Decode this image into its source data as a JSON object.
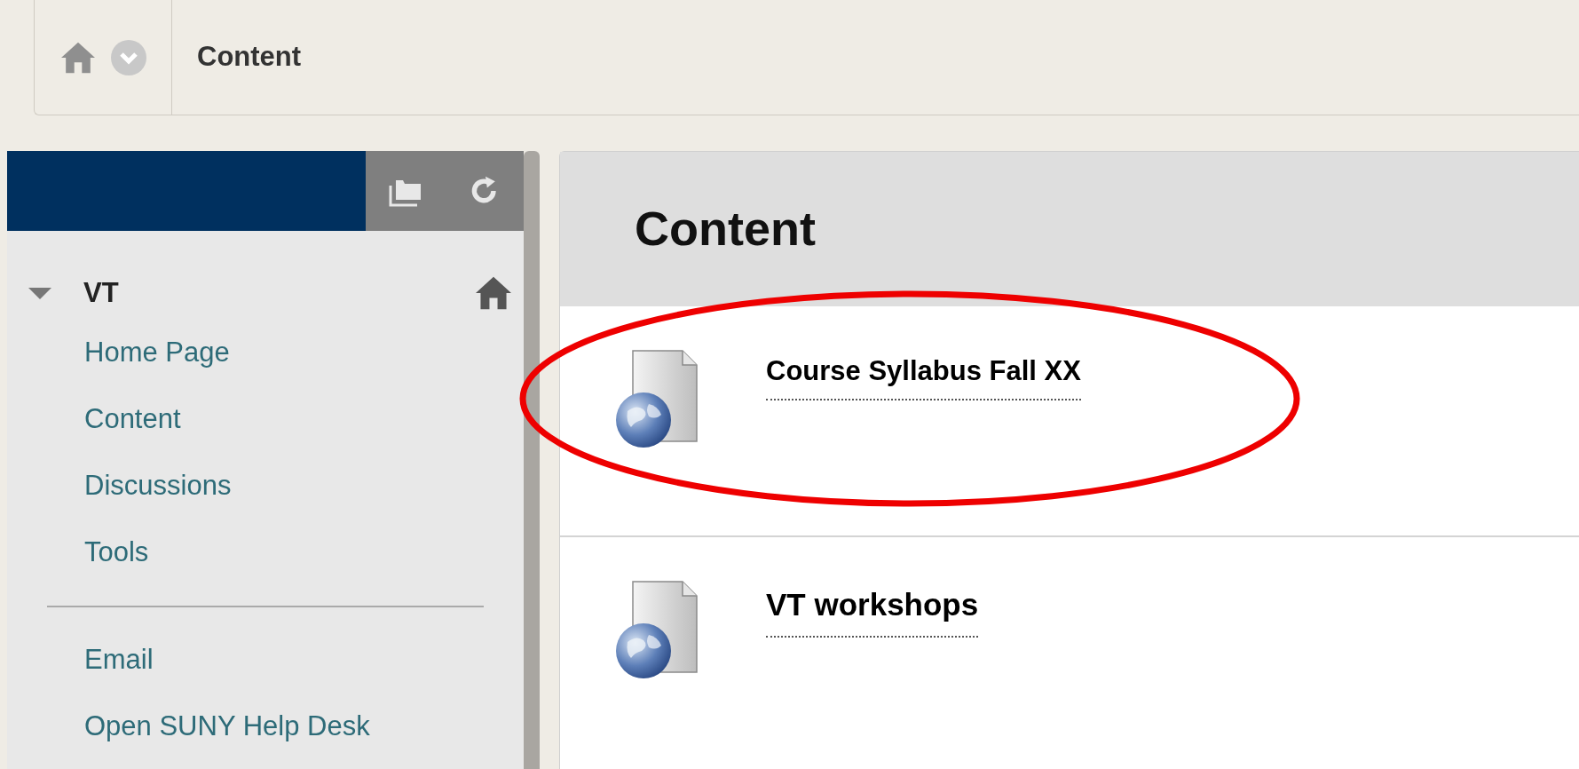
{
  "breadcrumb": {
    "current": "Content"
  },
  "course_menu": {
    "course": {
      "title": "VT",
      "expanded": true
    },
    "groups": [
      {
        "items": [
          "Home Page",
          "Content",
          "Discussions",
          "Tools"
        ]
      },
      {
        "items": [
          "Email",
          "Open SUNY Help Desk"
        ]
      }
    ]
  },
  "content": {
    "title": "Content",
    "items": [
      {
        "title": "Course Syllabus Fall XX",
        "annotated": true
      },
      {
        "title": "VT workshops",
        "annotated": false
      }
    ]
  }
}
